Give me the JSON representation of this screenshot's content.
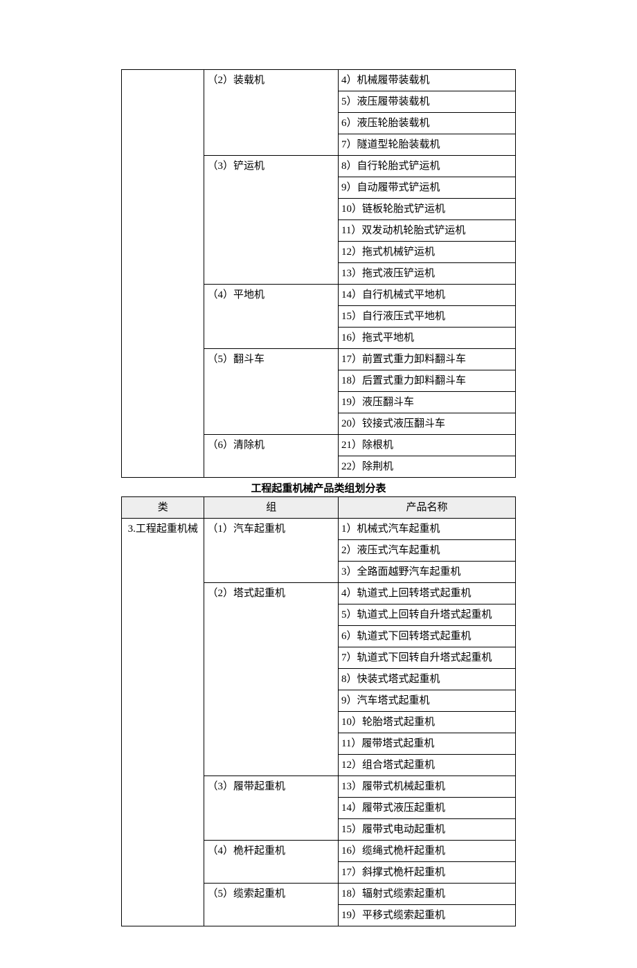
{
  "table1": {
    "rows": [
      {
        "category": "",
        "group": "（2）装载机",
        "product": "4）机械履带装载机"
      },
      {
        "product": "5）液压履带装载机"
      },
      {
        "product": "6）液压轮胎装载机"
      },
      {
        "product": "7）隧道型轮胎装载机"
      },
      {
        "group": "（3）铲运机",
        "product": "8）自行轮胎式铲运机"
      },
      {
        "product": "9）自动履带式铲运机"
      },
      {
        "product": "10）链板轮胎式铲运机"
      },
      {
        "product": "11）双发动机轮胎式铲运机"
      },
      {
        "product": "12）拖式机械铲运机"
      },
      {
        "product": "13）拖式液压铲运机"
      },
      {
        "group": "（4）平地机",
        "product": "14）自行机械式平地机"
      },
      {
        "product": "15）自行液压式平地机"
      },
      {
        "product": "16）拖式平地机"
      },
      {
        "group": "（5）翻斗车",
        "product": "17）前置式重力卸料翻斗车"
      },
      {
        "product": "18）后置式重力卸料翻斗车"
      },
      {
        "product": "19）液压翻斗车"
      },
      {
        "product": "20）铰接式液压翻斗车"
      },
      {
        "group": "（6）清除机",
        "product": "21）除根机"
      },
      {
        "product": "22）除荆机"
      }
    ]
  },
  "section_title": "工程起重机械产品类组划分表",
  "table2": {
    "headers": {
      "col1": "类",
      "col2": "组",
      "col3": "产品名称"
    },
    "rows": [
      {
        "category": "3.工程起重机械",
        "group": "（1）汽车起重机",
        "product": "1）机械式汽车起重机"
      },
      {
        "product": "2）液压式汽车起重机"
      },
      {
        "product": "3）全路面越野汽车起重机"
      },
      {
        "group": "（2）塔式起重机",
        "product": "4）轨道式上回转塔式起重机"
      },
      {
        "product": "5）轨道式上回转自升塔式起重机"
      },
      {
        "product": "6）轨道式下回转塔式起重机"
      },
      {
        "product": "7）轨道式下回转自升塔式起重机"
      },
      {
        "product": "8）快装式塔式起重机"
      },
      {
        "product": "9）汽车塔式起重机"
      },
      {
        "product": "10）轮胎塔式起重机"
      },
      {
        "product": "11）履带塔式起重机"
      },
      {
        "product": "12）组合塔式起重机"
      },
      {
        "group": "（3）履带起重机",
        "product": "13）履带式机械起重机"
      },
      {
        "product": "14）履带式液压起重机"
      },
      {
        "product": "15）履带式电动起重机"
      },
      {
        "group": "（4）桅杆起重机",
        "product": "16）缆绳式桅杆起重机"
      },
      {
        "product": "17）斜撑式桅杆起重机"
      },
      {
        "group": "（5）缆索起重机",
        "product": "18）辐射式缆索起重机"
      },
      {
        "product": "19）平移式缆索起重机"
      }
    ]
  }
}
